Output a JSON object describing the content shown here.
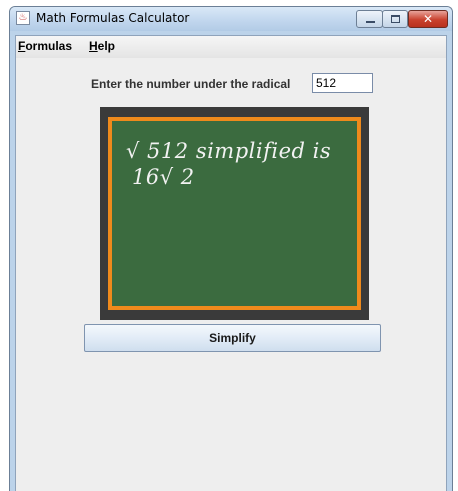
{
  "window": {
    "title": "Math Formulas Calculator",
    "close_glyph": "✕"
  },
  "menubar": {
    "formulas_mnemonic": "F",
    "formulas_rest": "ormulas",
    "help_mnemonic": "H",
    "help_rest": "elp"
  },
  "form": {
    "prompt_label": "Enter the number under the radical",
    "radical_value": "512"
  },
  "chalkboard": {
    "line1": "√ 512 simplified is",
    "line2": "16√ 2"
  },
  "actions": {
    "simplify_label": "Simplify"
  },
  "icons": [
    "java-app-icon",
    "minimize-icon",
    "maximize-icon",
    "close-icon"
  ],
  "colors": {
    "board_green": "#3b6b3f",
    "board_border_orange": "#ef8a1c",
    "frame_dark": "#3a3a3a",
    "close_red": "#c9412e"
  }
}
